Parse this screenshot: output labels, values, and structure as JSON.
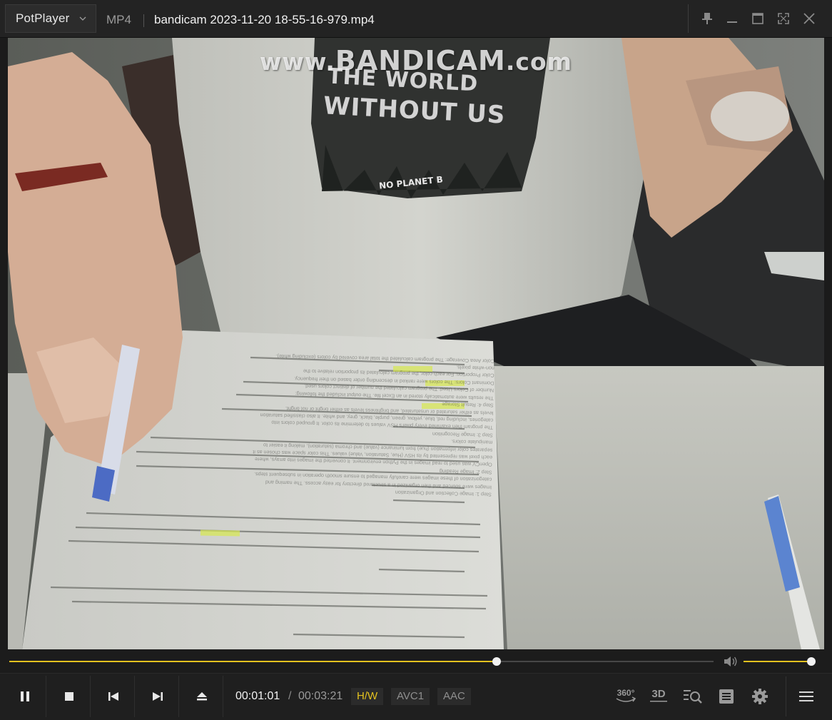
{
  "titlebar": {
    "app_name": "PotPlayer",
    "format": "MP4",
    "file_name": "bandicam 2023-11-20 18-55-16-979.mp4"
  },
  "video": {
    "watermark_prefix": "www.",
    "watermark_main": "BANDICAM",
    "watermark_suffix": ".com",
    "shirt_line1": "THE WORLD",
    "shirt_line2": "WITHOUT US",
    "shirt_small": "NO PLANET B",
    "paper_lines": [
      "Step 1: Image Collection and Organization",
      "Images were sourced and then organized in a structured directory for easy access. The naming and",
      "categorization of these images were carefully managed to ensure smooth operation in subsequent steps.",
      "Step 2: Image Reading",
      "OpenCV was used to read images in the Python environment. It converted the images into arrays, where",
      "each pixel was represented by its HSV (Hue, Saturation, Value) values. This color space was chosen as it",
      "separates color information (hue) from luminance (value) and chroma (saturation), making it easier to",
      "manipulate colors.",
      "Step 3: Image Recognition",
      "The program then examined every pixel's HSV values to determine its color. It grouped colors into",
      "categories, including red, blue, yellow, green, purple, black, grey, and white. It also classified saturation",
      "levels as either saturated or unsaturated, and brightness levels as either bright or not bright.",
      "Step 4: Result Storage",
      "The results were automatically stored in an Excel file. The output included the following:",
      "Number of Colors Used: The program calculated the number of distinct colors used.",
      "Dominant Colors: The colors were ranked in descending order based on their frequency.",
      "Color Proportion: For each color, the program calculated its proportion relative to the",
      "non-white pixels.",
      "Color Area Coverage: The program calculated the total area covered by colors (excluding white)."
    ]
  },
  "playback": {
    "progress": 0.692,
    "volume": 1.0,
    "current_time": "00:01:01",
    "separator": "/",
    "total_time": "00:03:21",
    "hw_label": "H/W",
    "video_codec": "AVC1",
    "audio_codec": "AAC",
    "label_360": "360°",
    "label_3d": "3D"
  },
  "colors": {
    "accent": "#e4c21f",
    "background": "#1b1b1b"
  },
  "icons": [
    "chevron-down-icon",
    "pin-icon",
    "minimize-icon",
    "maximize-icon",
    "fullscreen-icon",
    "close-icon",
    "volume-icon",
    "pause-icon",
    "stop-icon",
    "previous-icon",
    "next-icon",
    "eject-icon",
    "vr-360-icon",
    "3d-icon",
    "search-icon",
    "playlist-icon",
    "settings-icon",
    "menu-icon"
  ]
}
